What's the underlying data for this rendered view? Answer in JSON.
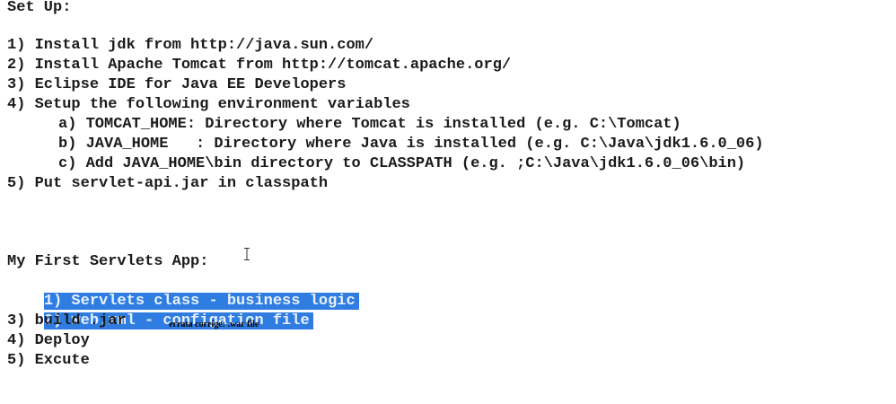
{
  "setup": {
    "heading": "Set Up:",
    "steps": [
      "1) Install jdk from http://java.sun.com/",
      "2) Install Apache Tomcat from http://tomcat.apache.org/",
      "3) Eclipse IDE for Java EE Developers",
      "4) Setup the following environment variables"
    ],
    "substeps": [
      "a) TOMCAT_HOME: Directory where Tomcat is installed (e.g. C:\\Tomcat)",
      "b) JAVA_HOME   : Directory where Java is installed (e.g. C:\\Java\\jdk1.6.0_06)",
      "c) Add JAVA_HOME\\bin directory to CLASSPATH (e.g. ;C:\\Java\\jdk1.6.0_06\\bin)"
    ],
    "last_step": "5) Put servlet-api.jar in classpath"
  },
  "app": {
    "heading": "My First Servlets App:",
    "steps": [
      "1) Servlets class - business logic",
      "2) web.xml - configation file",
      "3) build .jar",
      "4) Deploy",
      "5) Excute"
    ],
    "selected_steps": [
      0,
      1
    ],
    "selection_color": "#2f7de1"
  },
  "annotation": {
    "text": "errata corrige: .war file"
  },
  "cursor": {
    "icon": "text-cursor-icon"
  }
}
